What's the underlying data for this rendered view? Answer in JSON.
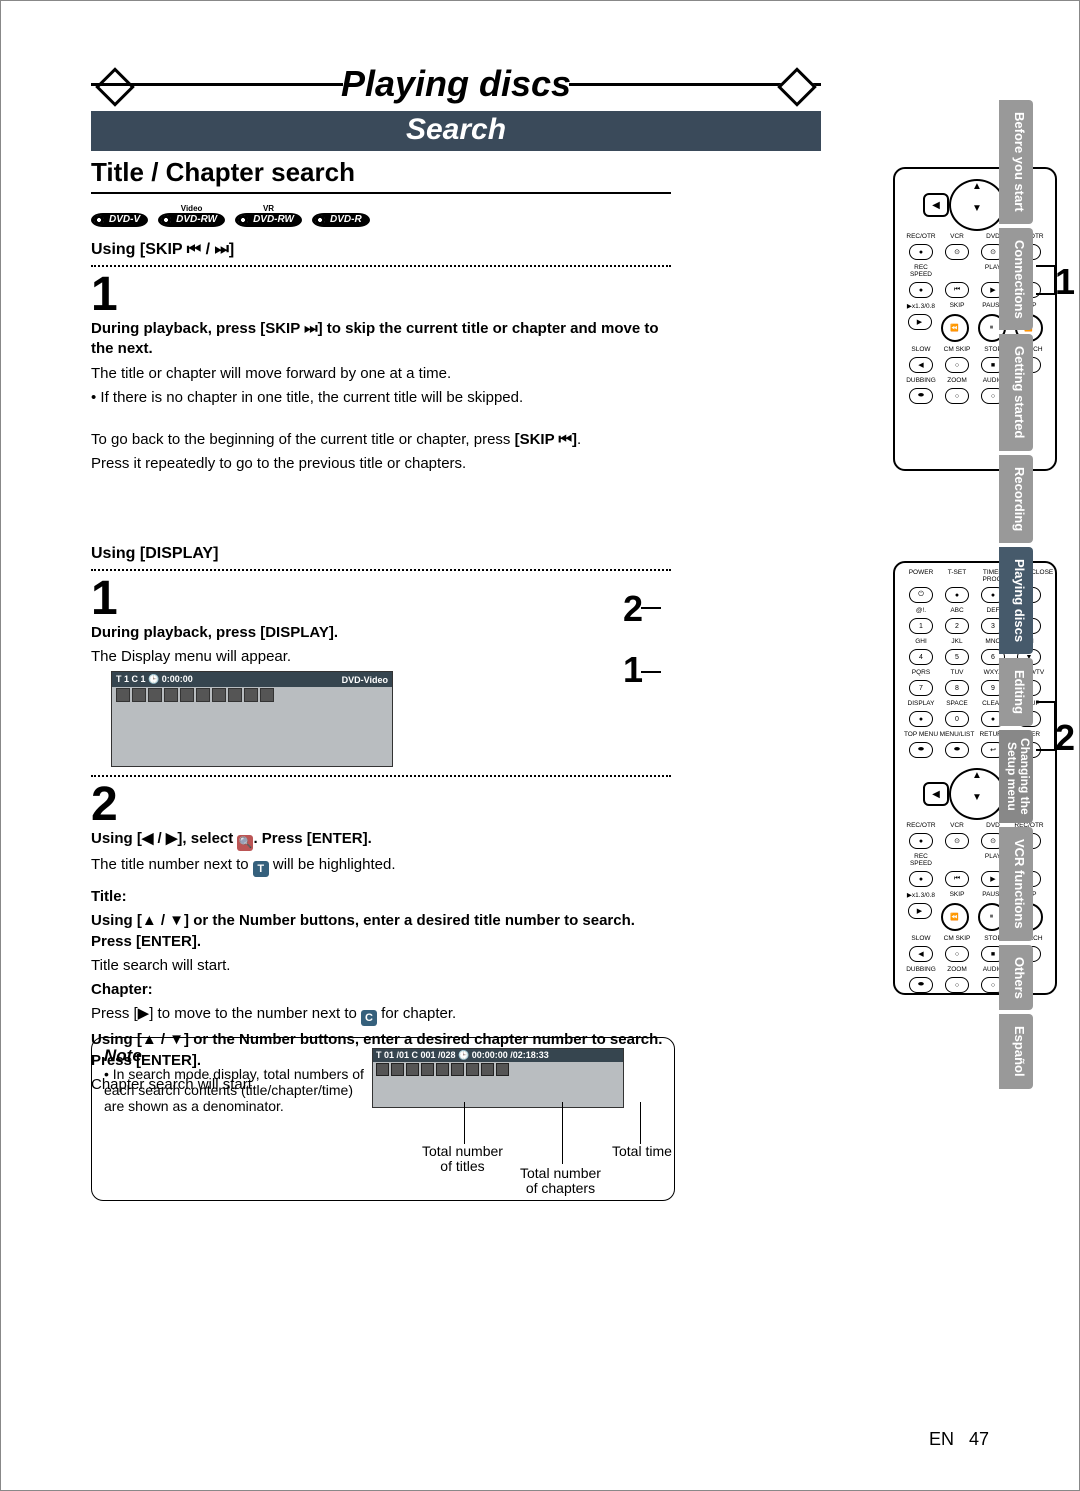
{
  "page": {
    "title": "Playing discs",
    "section": "Search",
    "subsection": "Title / Chapter search",
    "footer_lang": "EN",
    "footer_page": "47"
  },
  "badges": {
    "b1_sup": "",
    "b1": "DVD-V",
    "b2_sup": "Video",
    "b2": "DVD-RW",
    "b3_sup": "VR",
    "b3": "DVD-RW",
    "b4_sup": "",
    "b4": "DVD-R"
  },
  "skip": {
    "using": "Using [SKIP ⏮ / ⏭]",
    "num": "1",
    "p1_bold": "During playback, press [SKIP ⏭] to skip the current title or chapter and move to the next.",
    "p1_a": "The title or chapter will move forward by one at a time.",
    "p1_b": "•  If there is no chapter in one title, the current title will be skipped.",
    "p2": "To go back to the beginning of the current title or chapter, press ",
    "p2_bold": "[SKIP ⏮]",
    "p2_end": ".",
    "p3": "Press it repeatedly to go to the previous title or chapters."
  },
  "display": {
    "using": "Using [DISPLAY]",
    "s1_num": "1",
    "s1_bold": "During playback, press [DISPLAY].",
    "s1_text": "The Display menu will appear.",
    "panel1_row": "T  1  C 1  🕒 0:00:00",
    "panel1_right": "DVD-Video",
    "s2_num": "2",
    "s2_line1_a": "Using [◀ / ▶], select ",
    "s2_line1_b": ". Press [ENTER].",
    "s2_line2_a": "The title number next to ",
    "s2_line2_b": " will be highlighted.",
    "title_lbl": "Title:",
    "title_bold": "Using [▲ / ▼] or the Number buttons, enter a desired title number to search. Press [ENTER].",
    "title_txt": "Title search will start.",
    "chap_lbl": "Chapter:",
    "chap_txt1_a": "Press [▶] to move to the number next to ",
    "chap_txt1_b": " for chapter.",
    "chap_bold": "Using [▲ / ▼] or the Number buttons, enter a desired chapter number to search. Press [ENTER].",
    "chap_txt2": "Chapter search will start."
  },
  "note": {
    "title": "Note",
    "bullet": "• In search mode display, total numbers of each search contents (title/chapter/time) are shown as a denominator.",
    "row": "T 01 /01    C  001 /028    🕒 00:00:00 /02:18:33",
    "lbl_titles": "Total number\nof titles",
    "lbl_chapters": "Total number\nof chapters",
    "lbl_time": "Total time"
  },
  "remote_labels": {
    "rec_otr": "REC/OTR",
    "vcr": "VCR",
    "dvd": "DVD",
    "rec_otrb": "REC/OTR",
    "rec_speed": "REC SPEED",
    "play": "PLAY",
    "skip": "SKIP",
    "pause": "PAUSE",
    "x13": "▶x1.3/0.8",
    "slow": "SLOW",
    "cmskip": "CM SKIP",
    "stop": "STOP",
    "search": "SEARCH",
    "dubbing": "DUBBING",
    "zoom": "ZOOM",
    "audio": "AUDIO",
    "power": "POWER",
    "tset": "T-SET",
    "timer": "TIMER PROG.",
    "open": "OPEN/CLOSE",
    "abc": "ABC",
    "def": "DEF",
    "ghi": "GHI",
    "jkl": "JKL",
    "mno": "MNO",
    "ch": "CH",
    "pqrs": "PQRS",
    "tuv": "TUV",
    "wxyz": "WXYZ",
    "videotv": "VIDEO/TV",
    "display_btn": "DISPLAY",
    "space": "SPACE",
    "clear": "CLEAR",
    "setup": "SETUP",
    "topmenu": "TOP MENU",
    "menulist": "MENU/LIST",
    "return": "RETURN",
    "enter": "ENTER"
  },
  "callouts": {
    "r1": "1",
    "r2a": "2",
    "r2b": "1",
    "r2c": "2"
  },
  "tabs": {
    "t1": "Before you start",
    "t2": "Connections",
    "t3": "Getting started",
    "t4": "Recording",
    "t5": "Playing discs",
    "t6": "Editing",
    "t7": "Changing the\nSetup menu",
    "t8": "VCR functions",
    "t9": "Others",
    "t10": "Español"
  }
}
